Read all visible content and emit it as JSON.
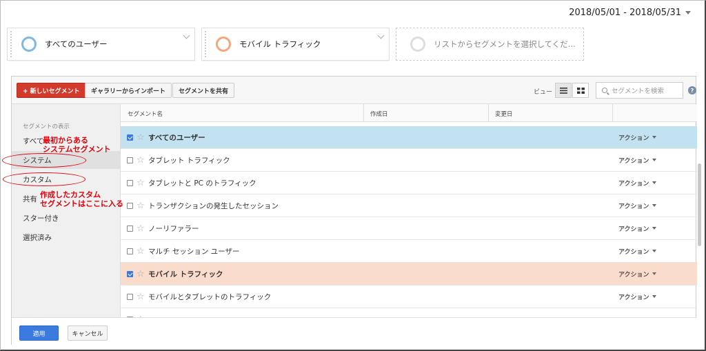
{
  "date_range": "2018/05/01 - 2018/05/31",
  "segment_slots": [
    {
      "label": "すべてのユーザー",
      "ring_color": "#7fb8e0"
    },
    {
      "label": "モバイル トラフィック",
      "ring_color": "#f4a77a"
    },
    {
      "label": "リストからセグメントを選択してくだ...",
      "ring_color": "#dddddd"
    }
  ],
  "toolbar": {
    "new_segment": "+ 新しいセグメント",
    "import_gallery": "ギャラリーからインポート",
    "share_segments": "セグメントを共有",
    "view_label": "ビュー",
    "search_placeholder": "セグメントを検索",
    "help": "?"
  },
  "sidebar": {
    "heading": "セグメントの表示",
    "items": [
      "すべて",
      "システム",
      "カスタム",
      "共有",
      "スター付き",
      "選択済み"
    ]
  },
  "table": {
    "columns": [
      "セグメント名",
      "作成日",
      "変更日"
    ],
    "rows": [
      {
        "name": "すべてのユーザー",
        "checked": true,
        "action": "アクション"
      },
      {
        "name": "タブレット トラフィック",
        "checked": false,
        "action": "アクション"
      },
      {
        "name": "タブレットと PC のトラフィック",
        "checked": false,
        "action": "アクション"
      },
      {
        "name": "トランザクションの発生したセッション",
        "checked": false,
        "action": "アクション"
      },
      {
        "name": "ノーリファラー",
        "checked": false,
        "action": "アクション"
      },
      {
        "name": "マルチ セッション ユーザー",
        "checked": false,
        "action": "アクション"
      },
      {
        "name": "モバイル トラフィック",
        "checked": true,
        "action": "アクション"
      },
      {
        "name": "モバイルとタブレットのトラフィック",
        "checked": false,
        "action": "アクション"
      }
    ]
  },
  "footer": {
    "apply": "適用",
    "cancel": "キャンセル"
  },
  "annotations": {
    "system_line1": "最初からある",
    "system_line2": "システムセグメント",
    "custom_line1": "作成したカスタム",
    "custom_line2": "セグメントはここに入る"
  },
  "colors": {
    "accent_red": "#d23a2e",
    "apply_blue": "#3b7be0",
    "row_blue": "#c3e2f1",
    "row_orange": "#f9dccb",
    "annotation_red": "#e0000a"
  }
}
